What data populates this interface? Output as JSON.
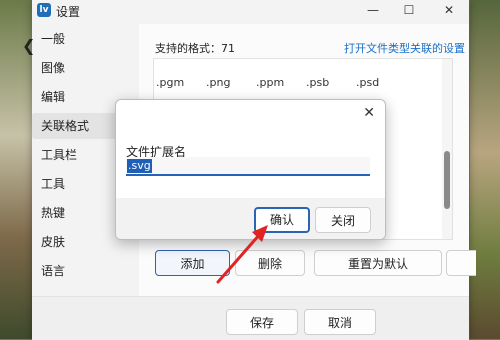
{
  "window": {
    "title": "设置",
    "app_icon": "lv",
    "controls": {
      "minimize": "—",
      "maximize": "☐",
      "close": "✕"
    },
    "back": "❮"
  },
  "sidebar": {
    "items": [
      {
        "label": "一般"
      },
      {
        "label": "图像"
      },
      {
        "label": "编辑"
      },
      {
        "label": "关联格式",
        "active": true
      },
      {
        "label": "工具栏"
      },
      {
        "label": "工具"
      },
      {
        "label": "热键"
      },
      {
        "label": "皮肤"
      },
      {
        "label": "语言"
      }
    ]
  },
  "formats": {
    "label": "支持的格式：71",
    "link": "打开文件类型关联的设置",
    "row1": [
      ".pgm",
      ".png",
      ".ppm",
      ".psb",
      ".psd"
    ]
  },
  "buttons": {
    "add": "添加",
    "delete": "删除",
    "reset": "重置为默认",
    "save": "保存",
    "cancel": "取消"
  },
  "dialog": {
    "close_icon": "✕",
    "label": "文件扩展名",
    "input_value": ".svg",
    "ok": "确认",
    "close": "关闭"
  },
  "colors": {
    "accent": "#2563b9",
    "annotation_arrow": "#e02424"
  }
}
